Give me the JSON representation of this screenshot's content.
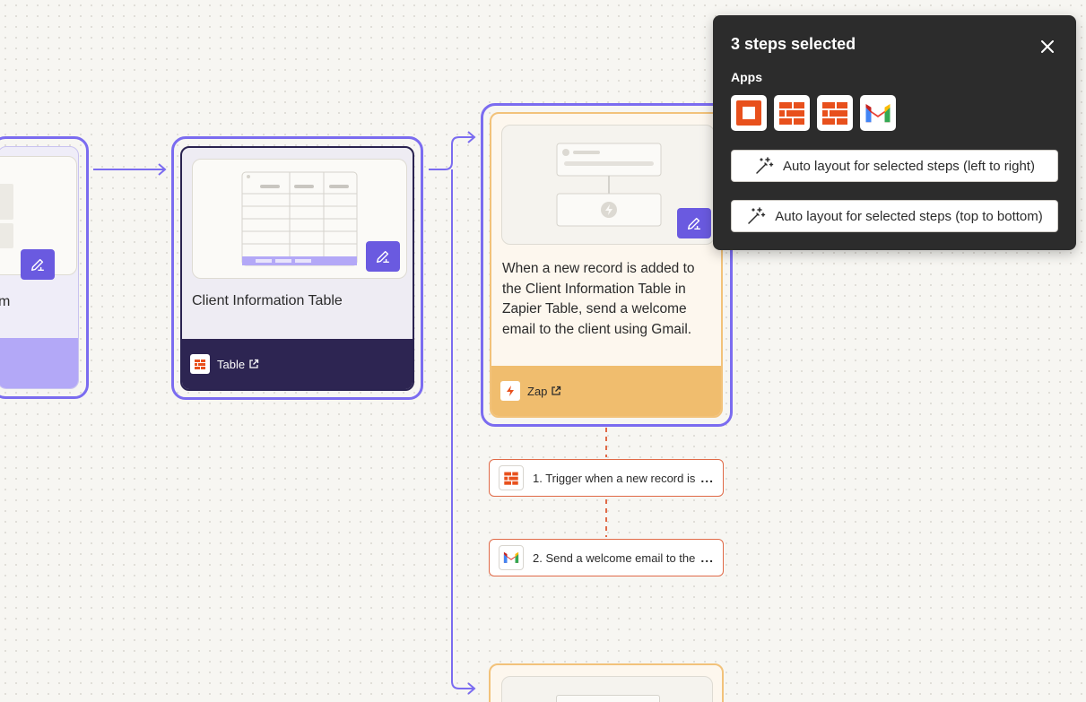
{
  "canvas": {
    "accent_color": "#7b6cf0",
    "edit_button_color": "#6a5ae0",
    "connector_dash_color": "#e06a47"
  },
  "left_card": {
    "title_fragment": "m"
  },
  "table_card": {
    "title": "Client Information Table",
    "footer_app_icon": "zapier-tables-icon",
    "footer_label": "Table",
    "footer_link_icon": "external-link-icon",
    "footer_color": "#2d2552"
  },
  "zap_card": {
    "description": "When a new record is added to the Client Information Table in Zapier Table, send a welcome email to the client using Gmail.",
    "footer_app_icon": "zap-bolt-icon",
    "footer_label": "Zap",
    "footer_link_icon": "external-link-icon",
    "footer_color": "#f0bd6e"
  },
  "steps": [
    {
      "icon": "zapier-tables-icon",
      "label": "1. Trigger when a new record is",
      "more": "..."
    },
    {
      "icon": "gmail-icon",
      "label": "2. Send a welcome email to the",
      "more": "..."
    }
  ],
  "panel": {
    "title": "3 steps selected",
    "close_icon": "close-icon",
    "apps_label": "Apps",
    "apps": [
      "zapier-interfaces-icon",
      "zapier-tables-icon",
      "zapier-tables-icon",
      "gmail-icon"
    ],
    "buttons": [
      {
        "icon": "magic-wand-icon",
        "label": "Auto layout for selected steps (left to right)"
      },
      {
        "icon": "magic-wand-icon",
        "label": "Auto layout for selected steps (top to bottom)"
      }
    ]
  }
}
